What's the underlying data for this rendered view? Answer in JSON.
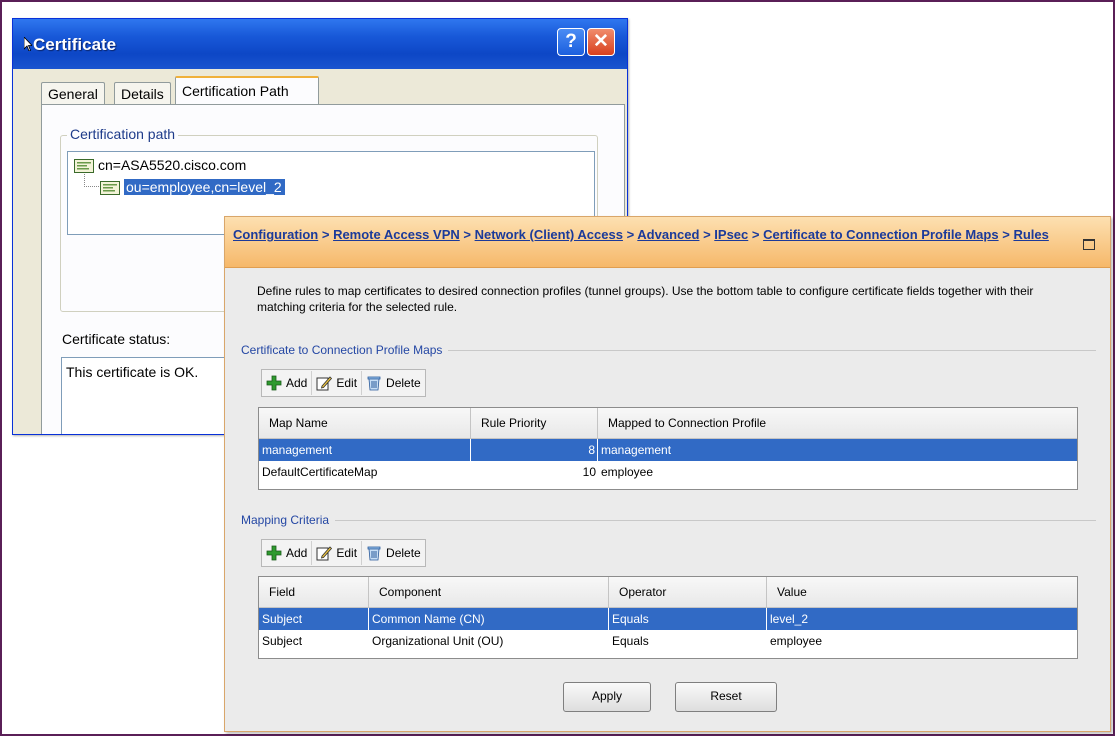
{
  "certificate_window": {
    "title": "Certificate",
    "help_glyph": "?",
    "close_glyph": "✕",
    "tabs": [
      {
        "label": "General"
      },
      {
        "label": "Details"
      },
      {
        "label": "Certification Path"
      }
    ],
    "active_tab": "Certification Path",
    "path_group_label": "Certification path",
    "path_items": [
      {
        "label": "cn=ASA5520.cisco.com",
        "icon": "certificate-icon"
      },
      {
        "label": "ou=employee,cn=level_2",
        "icon": "certificate-icon",
        "selected": true
      }
    ],
    "status_label": "Certificate status:",
    "status_text": "This certificate is OK."
  },
  "config_panel": {
    "breadcrumb": [
      {
        "label": "Configuration"
      },
      {
        "label": "Remote Access VPN"
      },
      {
        "label": "Network (Client) Access"
      },
      {
        "label": "Advanced"
      },
      {
        "label": "IPsec"
      },
      {
        "label": "Certificate to Connection Profile Maps"
      },
      {
        "label": "Rules"
      }
    ],
    "breadcrumb_separator": ">",
    "description": "Define rules to map certificates to desired connection profiles (tunnel groups). Use the bottom table to configure certificate fields together with their matching criteria for the selected rule.",
    "maps_section": {
      "title": "Certificate to Connection Profile Maps",
      "toolbar": {
        "add": "Add",
        "edit": "Edit",
        "delete": "Delete"
      },
      "columns": [
        "Map Name",
        "Rule Priority",
        "Mapped to Connection Profile"
      ],
      "rows": [
        {
          "map_name": "management",
          "priority": "8",
          "profile": "management",
          "selected": true
        },
        {
          "map_name": "DefaultCertificateMap",
          "priority": "10",
          "profile": "employee",
          "selected": false
        }
      ]
    },
    "criteria_section": {
      "title": "Mapping Criteria",
      "toolbar": {
        "add": "Add",
        "edit": "Edit",
        "delete": "Delete"
      },
      "columns": [
        "Field",
        "Component",
        "Operator",
        "Value"
      ],
      "rows": [
        {
          "field": "Subject",
          "component": "Common Name (CN)",
          "operator": "Equals",
          "value": "level_2",
          "selected": true
        },
        {
          "field": "Subject",
          "component": "Organizational Unit (OU)",
          "operator": "Equals",
          "value": "employee",
          "selected": false
        }
      ]
    },
    "buttons": {
      "apply": "Apply",
      "reset": "Reset"
    }
  },
  "colors": {
    "frame_border": "#5a1f57",
    "xp_title_blue": "#0d47c6",
    "selection_blue": "#316ac5",
    "panel_header_orange": "#f6b86a",
    "link_blue": "#1b3a9a"
  }
}
